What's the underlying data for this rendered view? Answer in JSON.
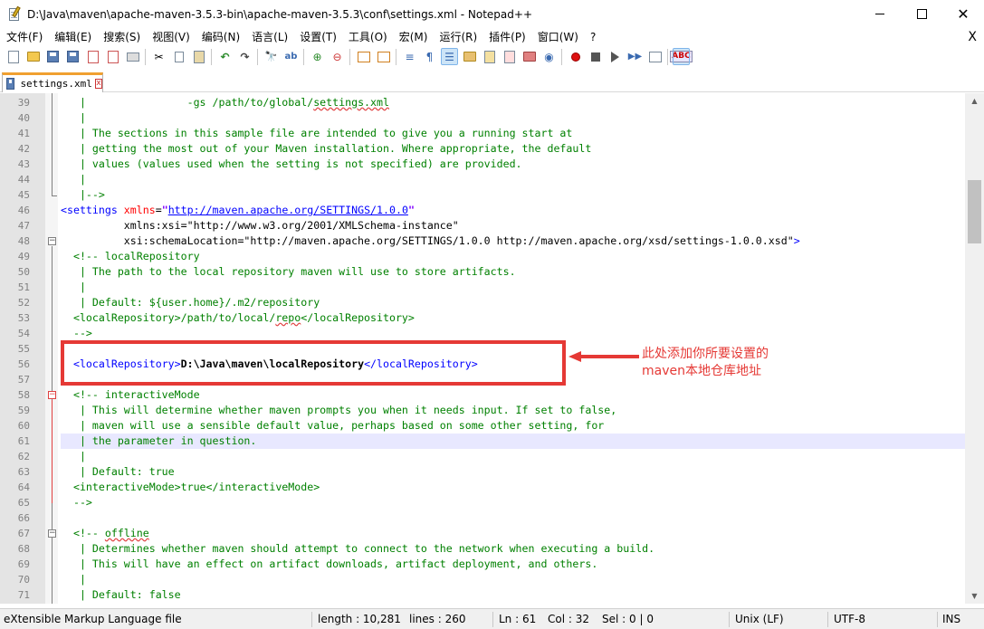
{
  "window": {
    "title": "D:\\Java\\maven\\apache-maven-3.5.3-bin\\apache-maven-3.5.3\\conf\\settings.xml - Notepad++",
    "minimize": "—",
    "maximize": "☐",
    "close": "✕"
  },
  "menu": {
    "items": [
      "文件(F)",
      "编辑(E)",
      "搜索(S)",
      "视图(V)",
      "编码(N)",
      "语言(L)",
      "设置(T)",
      "工具(O)",
      "宏(M)",
      "运行(R)",
      "插件(P)",
      "窗口(W)",
      "?"
    ],
    "close": "X"
  },
  "toolbar": {
    "icons": [
      "new-file-icon",
      "open-file-icon",
      "save-icon",
      "save-all-icon",
      "close-icon",
      "close-all-icon",
      "print-icon",
      "cut-icon",
      "copy-icon",
      "paste-icon",
      "undo-icon",
      "redo-icon",
      "find-icon",
      "replace-icon",
      "zoom-in-icon",
      "zoom-out-icon",
      "sync-vertical-icon",
      "sync-horizontal-icon",
      "word-wrap-icon",
      "show-all-chars-icon",
      "indent-guide-icon",
      "document-map-icon",
      "function-list-icon",
      "folder-workspace-icon",
      "monitoring-icon",
      "record-macro-icon",
      "stop-macro-icon",
      "play-macro-icon",
      "run-macro-multiple-icon",
      "save-macro-icon",
      "spell-check-icon"
    ],
    "spell_check_label": "ABC"
  },
  "tab": {
    "label": "settings.xml",
    "close": "x"
  },
  "editor": {
    "lines": [
      {
        "n": "39",
        "code": "   |                -gs /path/to/global/settings.xml"
      },
      {
        "n": "40",
        "code": "   |"
      },
      {
        "n": "41",
        "code": "   | The sections in this sample file are intended to give you a running start at"
      },
      {
        "n": "42",
        "code": "   | getting the most out of your Maven installation. Where appropriate, the default"
      },
      {
        "n": "43",
        "code": "   | values (values used when the setting is not specified) are provided."
      },
      {
        "n": "44",
        "code": "   |"
      },
      {
        "n": "45",
        "code": "   |-->"
      },
      {
        "n": "46",
        "code": "<settings xmlns=\"http://maven.apache.org/SETTINGS/1.0.0\""
      },
      {
        "n": "47",
        "code": "          xmlns:xsi=\"http://www.w3.org/2001/XMLSchema-instance\""
      },
      {
        "n": "48",
        "code": "          xsi:schemaLocation=\"http://maven.apache.org/SETTINGS/1.0.0 http://maven.apache.org/xsd/settings-1.0.0.xsd\">"
      },
      {
        "n": "49",
        "code": "  <!-- localRepository"
      },
      {
        "n": "50",
        "code": "   | The path to the local repository maven will use to store artifacts."
      },
      {
        "n": "51",
        "code": "   |"
      },
      {
        "n": "52",
        "code": "   | Default: ${user.home}/.m2/repository"
      },
      {
        "n": "53",
        "code": "  <localRepository>/path/to/local/repo</localRepository>"
      },
      {
        "n": "54",
        "code": "  -->"
      },
      {
        "n": "55",
        "code": ""
      },
      {
        "n": "56",
        "code": "  <localRepository>D:\\Java\\maven\\localRepository</localRepository>"
      },
      {
        "n": "57",
        "code": ""
      },
      {
        "n": "58",
        "code": "  <!-- interactiveMode"
      },
      {
        "n": "59",
        "code": "   | This will determine whether maven prompts you when it needs input. If set to false,"
      },
      {
        "n": "60",
        "code": "   | maven will use a sensible default value, perhaps based on some other setting, for"
      },
      {
        "n": "61",
        "code": "   | the parameter in question."
      },
      {
        "n": "62",
        "code": "   |"
      },
      {
        "n": "63",
        "code": "   | Default: true"
      },
      {
        "n": "64",
        "code": "  <interactiveMode>true</interactiveMode>"
      },
      {
        "n": "65",
        "code": "  -->"
      },
      {
        "n": "66",
        "code": ""
      },
      {
        "n": "67",
        "code": "  <!-- offline"
      },
      {
        "n": "68",
        "code": "   | Determines whether maven should attempt to connect to the network when executing a build."
      },
      {
        "n": "69",
        "code": "   | This will have an effect on artifact downloads, artifact deployment, and others."
      },
      {
        "n": "70",
        "code": "   |"
      },
      {
        "n": "71",
        "code": "   | Default: false"
      }
    ],
    "current_line": "61"
  },
  "annotation": {
    "line1": "此处添加你所要设置的",
    "line2": "maven本地仓库地址"
  },
  "status": {
    "file_type": "eXtensible Markup Language file",
    "length": "length : 10,281",
    "lines": "lines : 260",
    "ln": "Ln : 61",
    "col": "Col : 32",
    "sel": "Sel : 0 | 0",
    "eol": "Unix (LF)",
    "encoding": "UTF-8",
    "mode": "INS"
  },
  "colors": {
    "comment": "#008000",
    "tag": "#0000ff",
    "attribute": "#ff0000",
    "string": "#8000ff",
    "annotation": "#e53935",
    "current_line": "#e8e8ff"
  }
}
